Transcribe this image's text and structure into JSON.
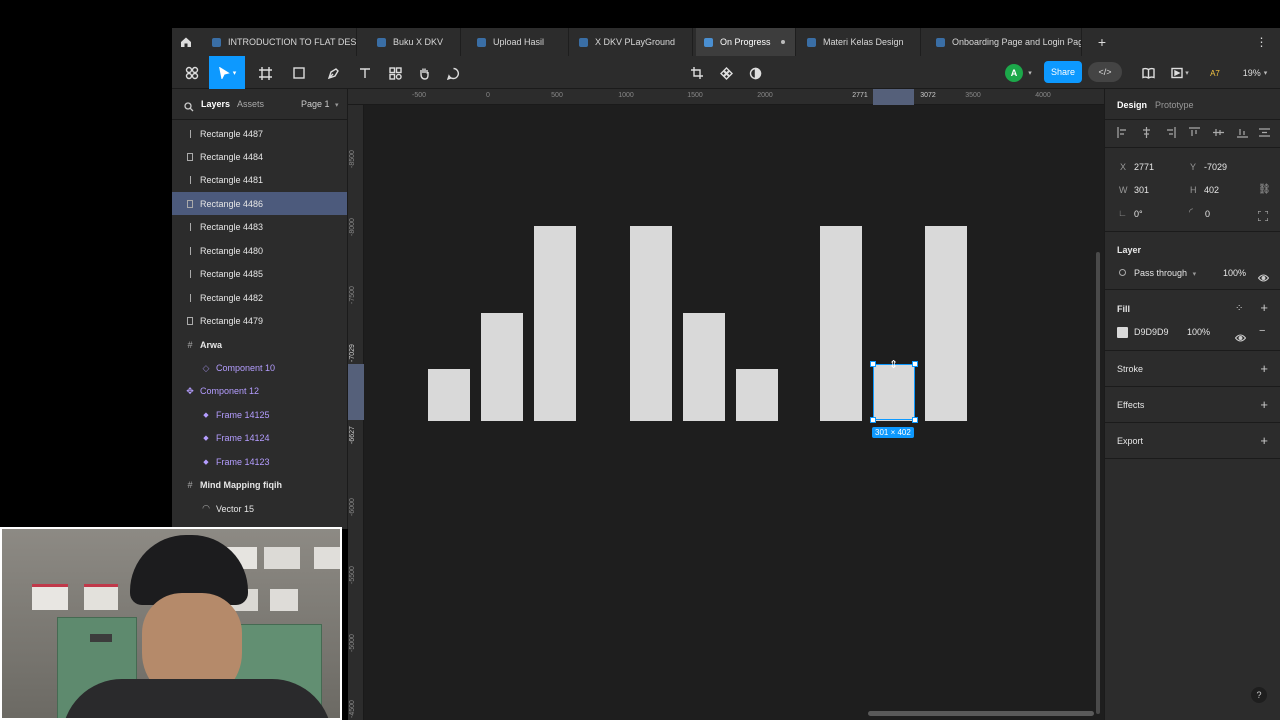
{
  "tabs": [
    {
      "label": "INTRODUCTION TO FLAT DESIG"
    },
    {
      "label": "Buku X DKV"
    },
    {
      "label": "Upload Hasil"
    },
    {
      "label": "X DKV PLayGround"
    },
    {
      "label": "On Progress"
    },
    {
      "label": "Materi Kelas Design"
    },
    {
      "label": "Onboarding Page and Login Pag"
    }
  ],
  "toolbar": {
    "avatar_initial": "A",
    "share_label": "Share",
    "code_icon": "</>",
    "zoom": "19%",
    "badge": "A7"
  },
  "left_panel": {
    "tab_layers": "Layers",
    "tab_assets": "Assets",
    "page": "Page 1",
    "layers": [
      {
        "name": "Rectangle 4487",
        "icon": "thin-rect"
      },
      {
        "name": "Rectangle 4484",
        "icon": "rect"
      },
      {
        "name": "Rectangle 4481",
        "icon": "thin-rect"
      },
      {
        "name": "Rectangle 4486",
        "icon": "rect"
      },
      {
        "name": "Rectangle 4483",
        "icon": "thin-rect"
      },
      {
        "name": "Rectangle 4480",
        "icon": "thin-rect"
      },
      {
        "name": "Rectangle 4485",
        "icon": "thin-rect"
      },
      {
        "name": "Rectangle 4482",
        "icon": "thin-rect"
      },
      {
        "name": "Rectangle 4479",
        "icon": "rect"
      },
      {
        "name": "Arwa",
        "icon": "frame"
      },
      {
        "name": "Component 10",
        "icon": "component-instance"
      },
      {
        "name": "Component 12",
        "icon": "component"
      },
      {
        "name": "Frame 14125",
        "icon": "diamond"
      },
      {
        "name": "Frame 14124",
        "icon": "diamond"
      },
      {
        "name": "Frame 14123",
        "icon": "diamond"
      },
      {
        "name": "Mind Mapping fiqih",
        "icon": "frame"
      },
      {
        "name": "Vector 15",
        "icon": "vector"
      }
    ]
  },
  "rulers": {
    "top": [
      "-500",
      "0",
      "500",
      "1000",
      "1500",
      "2000",
      "2771",
      "3072",
      "3500",
      "4000"
    ],
    "left": [
      "-8500",
      "-8000",
      "-7500",
      "-7029",
      "-6627",
      "-6000",
      "-5500",
      "-5000",
      "-4500"
    ]
  },
  "selection_label": "301 × 402",
  "right_panel": {
    "tab_design": "Design",
    "tab_prototype": "Prototype",
    "x_label": "X",
    "x_value": "2771",
    "y_label": "Y",
    "y_value": "-7029",
    "w_label": "W",
    "w_value": "301",
    "h_label": "H",
    "h_value": "402",
    "rotation": "0°",
    "radius": "0",
    "layer_title": "Layer",
    "blend_mode": "Pass through",
    "layer_opacity": "100%",
    "fill_title": "Fill",
    "fill_hex": "D9D9D9",
    "fill_opacity": "100%",
    "stroke_title": "Stroke",
    "effects_title": "Effects",
    "export_title": "Export"
  },
  "colors": {
    "accent": "#0d99ff",
    "bar_fill": "#d9d9d9",
    "avatar_green": "#1ca84a"
  }
}
